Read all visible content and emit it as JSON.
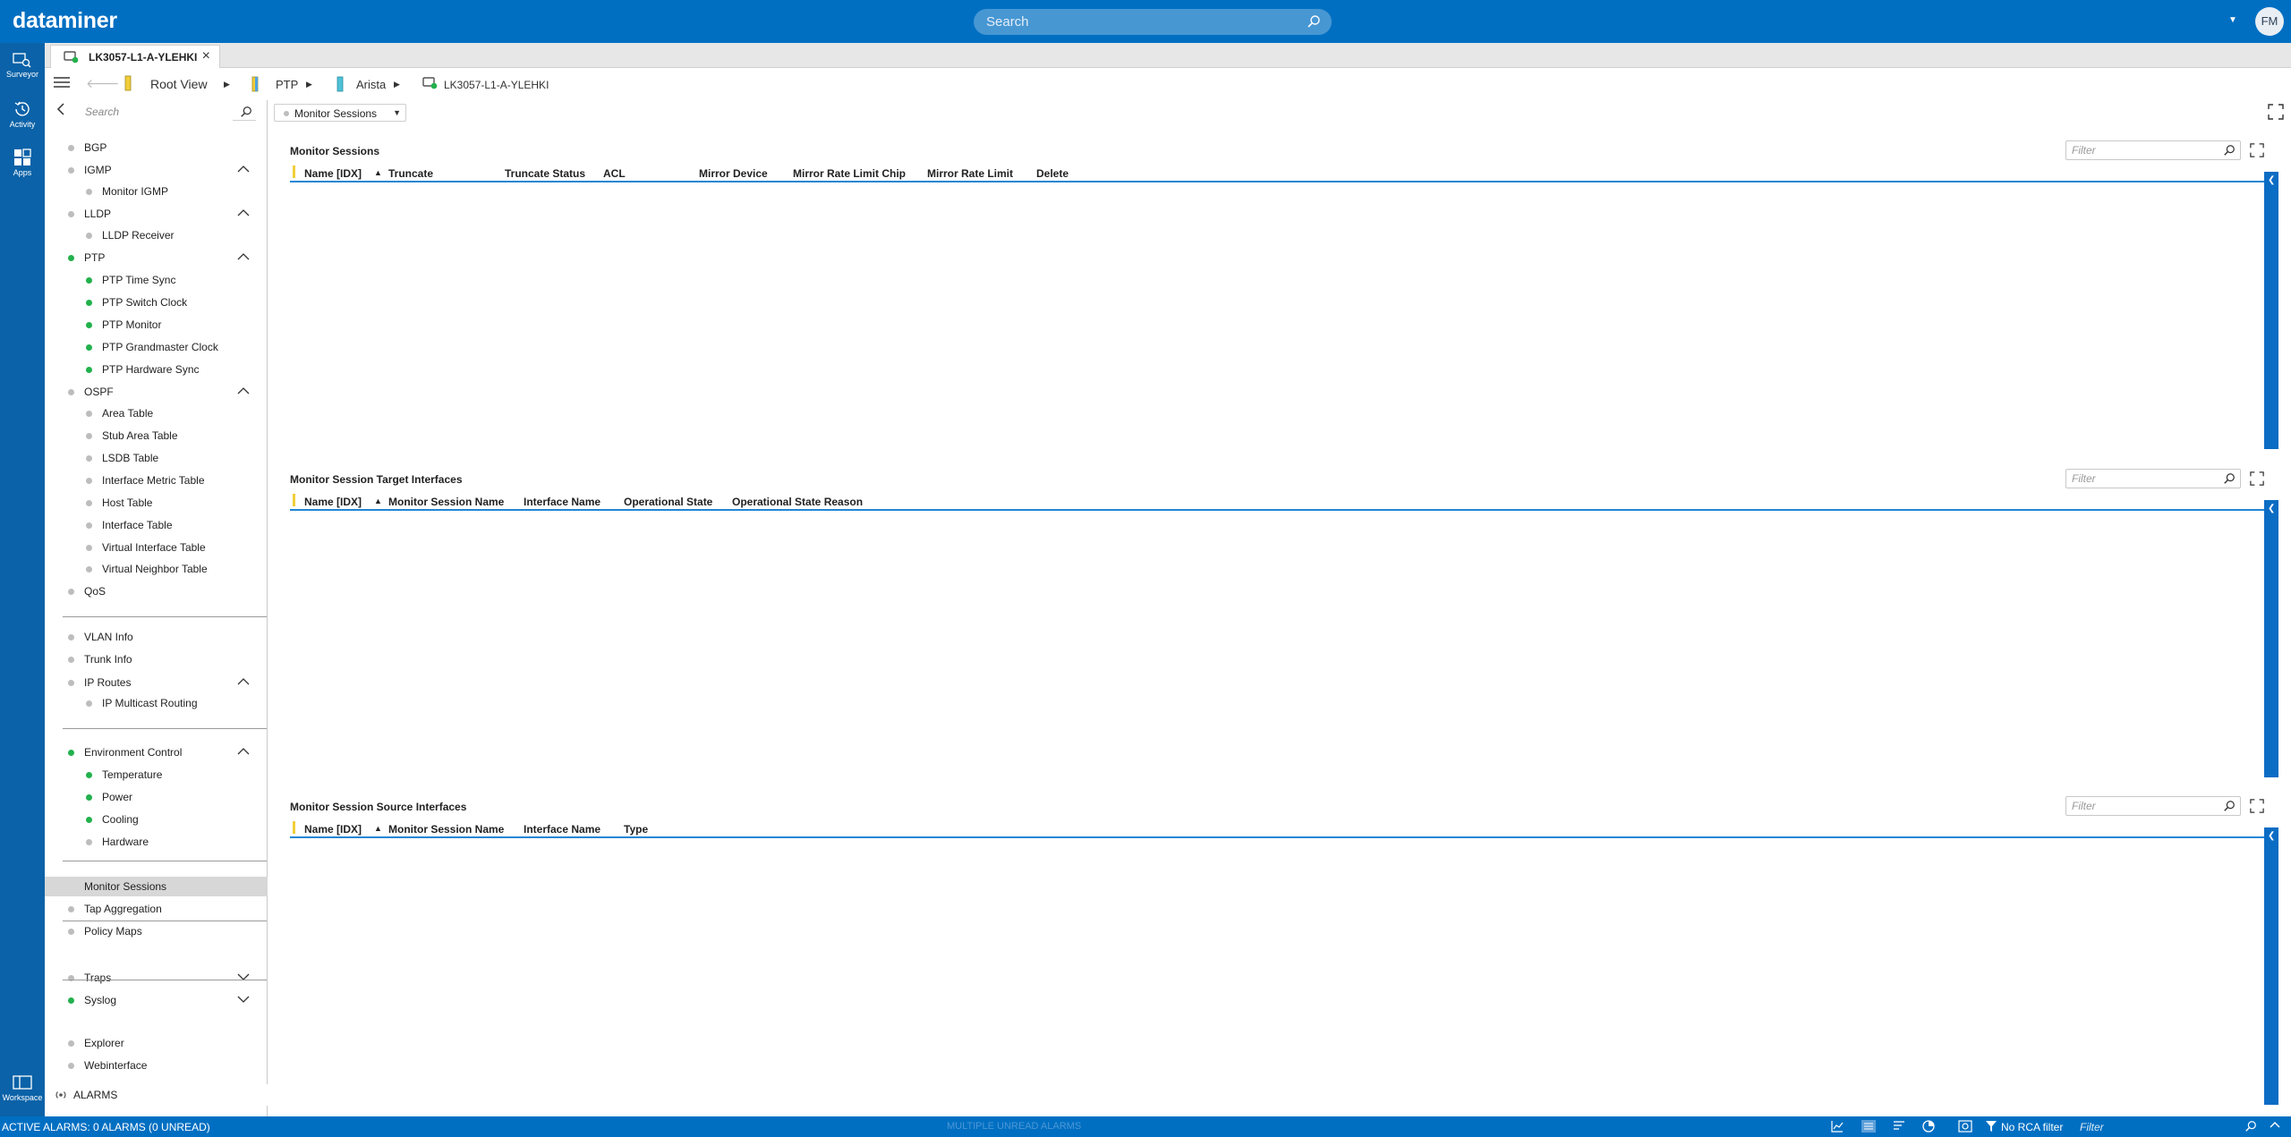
{
  "topbar": {
    "brand": "dataminer",
    "search_placeholder": "Search",
    "avatar_initials": "FM"
  },
  "rail": {
    "items": [
      {
        "label": "Surveyor",
        "icon": "surveyor-icon"
      },
      {
        "label": "Activity",
        "icon": "activity-icon"
      },
      {
        "label": "Apps",
        "icon": "apps-icon"
      }
    ],
    "workspace_label": "Workspace"
  },
  "tab": {
    "label": "LK3057-L1-A-YLEHKI"
  },
  "breadcrumb": {
    "root": "Root View",
    "items": [
      "PTP",
      "Arista",
      "LK3057-L1-A-YLEHKI"
    ]
  },
  "left_panel": {
    "search_placeholder": "Search",
    "items": [
      {
        "label": "BGP",
        "status": "gray",
        "level": 1
      },
      {
        "label": "IGMP",
        "status": "gray",
        "level": 1,
        "chevron": "up"
      },
      {
        "label": "Monitor IGMP",
        "status": "gray",
        "level": 2
      },
      {
        "label": "LLDP",
        "status": "gray",
        "level": 1,
        "chevron": "up"
      },
      {
        "label": "LLDP Receiver",
        "status": "gray",
        "level": 2
      },
      {
        "label": "PTP",
        "status": "green",
        "level": 1,
        "chevron": "up"
      },
      {
        "label": "PTP Time Sync",
        "status": "green",
        "level": 2
      },
      {
        "label": "PTP Switch Clock",
        "status": "green",
        "level": 2
      },
      {
        "label": "PTP Monitor",
        "status": "green",
        "level": 2
      },
      {
        "label": "PTP Grandmaster Clock",
        "status": "green",
        "level": 2
      },
      {
        "label": "PTP Hardware Sync",
        "status": "green",
        "level": 2
      },
      {
        "label": "OSPF",
        "status": "gray",
        "level": 1,
        "chevron": "up"
      },
      {
        "label": "Area Table",
        "status": "gray",
        "level": 2
      },
      {
        "label": "Stub Area Table",
        "status": "gray",
        "level": 2
      },
      {
        "label": "LSDB Table",
        "status": "gray",
        "level": 2
      },
      {
        "label": "Interface Metric Table",
        "status": "gray",
        "level": 2
      },
      {
        "label": "Host Table",
        "status": "gray",
        "level": 2
      },
      {
        "label": "Interface Table",
        "status": "gray",
        "level": 2
      },
      {
        "label": "Virtual Interface Table",
        "status": "gray",
        "level": 2
      },
      {
        "label": "Virtual Neighbor Table",
        "status": "gray",
        "level": 2
      },
      {
        "label": "QoS",
        "status": "gray",
        "level": 1
      },
      {
        "label": "VLAN Info",
        "status": "gray",
        "level": 1
      },
      {
        "label": "Trunk Info",
        "status": "gray",
        "level": 1
      },
      {
        "label": "IP Routes",
        "status": "gray",
        "level": 1,
        "chevron": "up"
      },
      {
        "label": "IP Multicast Routing",
        "status": "gray",
        "level": 2
      },
      {
        "label": "Environment Control",
        "status": "green",
        "level": 1,
        "chevron": "up"
      },
      {
        "label": "Temperature",
        "status": "green",
        "level": 2
      },
      {
        "label": "Power",
        "status": "green",
        "level": 2
      },
      {
        "label": "Cooling",
        "status": "green",
        "level": 2
      },
      {
        "label": "Hardware",
        "status": "gray",
        "level": 2
      },
      {
        "label": "Monitor Sessions",
        "status": "none",
        "level": 1,
        "selected": true
      },
      {
        "label": "Tap Aggregation",
        "status": "gray",
        "level": 1
      },
      {
        "label": "Policy Maps",
        "status": "gray",
        "level": 1
      },
      {
        "label": "Traps",
        "status": "gray",
        "level": 1,
        "chevron": "down"
      },
      {
        "label": "Syslog",
        "status": "green",
        "level": 1,
        "chevron": "down"
      },
      {
        "label": "Explorer",
        "status": "gray",
        "level": 1
      },
      {
        "label": "Webinterface",
        "status": "gray",
        "level": 1
      }
    ]
  },
  "content": {
    "view_selector": "Monitor Sessions",
    "tables": [
      {
        "title": "Monitor Sessions",
        "filter_placeholder": "Filter",
        "columns": [
          "Name [IDX]",
          "Truncate",
          "Truncate Status",
          "ACL",
          "Mirror Device",
          "Mirror Rate Limit Chip",
          "Mirror Rate Limit",
          "Delete"
        ]
      },
      {
        "title": "Monitor Session Target Interfaces",
        "filter_placeholder": "Filter",
        "columns": [
          "Name [IDX]",
          "Monitor Session Name",
          "Interface Name",
          "Operational State",
          "Operational State Reason"
        ]
      },
      {
        "title": "Monitor Session Source Interfaces",
        "filter_placeholder": "Filter",
        "columns": [
          "Name [IDX]",
          "Monitor Session Name",
          "Interface Name",
          "Type"
        ]
      }
    ]
  },
  "alarms_row": {
    "label": "ALARMS"
  },
  "statusbar": {
    "left": "ACTIVE ALARMS: 0 ALARMS (0 UNREAD)",
    "center": "MULTIPLE UNREAD ALARMS",
    "rca": "No RCA filter",
    "filter_placeholder": "Filter"
  },
  "colors": {
    "brand_blue": "#006fc2",
    "rail_blue": "#0b62a8",
    "status_green": "#22b14c",
    "status_gray": "#bdbdbd",
    "header_underline": "#1f86d4",
    "sort_yellow": "#f1cd3a"
  }
}
